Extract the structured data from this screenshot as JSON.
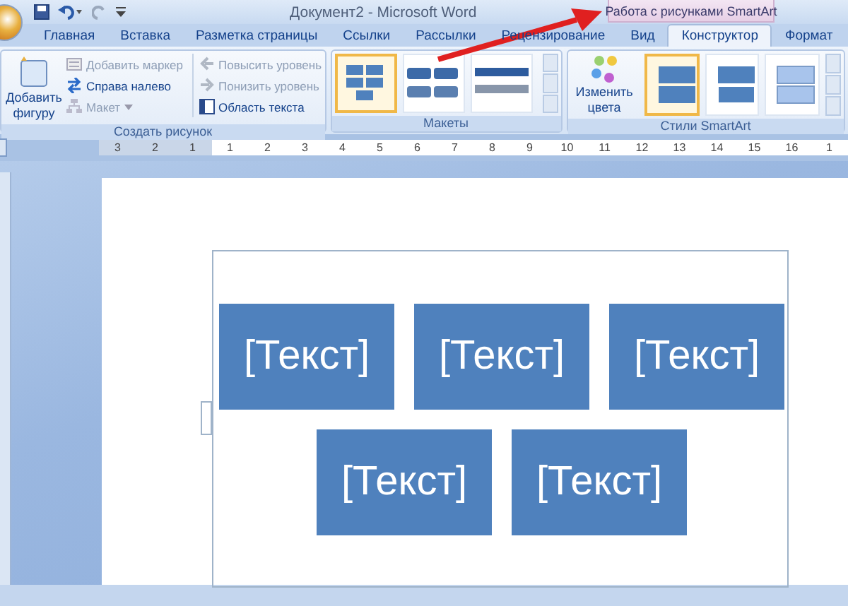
{
  "window": {
    "title": "Документ2 - Microsoft Word"
  },
  "contextual_header": "Работа с рисунками SmartArt",
  "tabs": [
    {
      "label": "Главная",
      "selected": false
    },
    {
      "label": "Вставка",
      "selected": false
    },
    {
      "label": "Разметка страницы",
      "selected": false
    },
    {
      "label": "Ссылки",
      "selected": false
    },
    {
      "label": "Рассылки",
      "selected": false
    },
    {
      "label": "Рецензирование",
      "selected": false
    },
    {
      "label": "Вид",
      "selected": false
    },
    {
      "label": "Конструктор",
      "selected": true
    },
    {
      "label": "Формат",
      "selected": false
    }
  ],
  "create_group": {
    "label": "Создать рисунок",
    "big_button": {
      "label": "Добавить фигуру"
    },
    "commands": [
      {
        "label": "Добавить маркер",
        "disabled": true,
        "kind": "bullet"
      },
      {
        "label": "Справа налево",
        "disabled": false,
        "kind": "swap"
      },
      {
        "label": "Макет",
        "disabled": true,
        "kind": "layout"
      },
      {
        "label": "Повысить уровень",
        "disabled": true,
        "kind": "promote"
      },
      {
        "label": "Понизить уровень",
        "disabled": true,
        "kind": "demote"
      },
      {
        "label": "Область текста",
        "disabled": false,
        "kind": "pane"
      }
    ]
  },
  "layouts_group": {
    "label": "Макеты",
    "items": [
      {
        "selected": true
      },
      {
        "selected": false
      },
      {
        "selected": false
      }
    ]
  },
  "styles_group": {
    "label": "Стили SmartArt",
    "colors_button": {
      "label": "Изменить цвета"
    },
    "items": [
      {
        "selected": true
      },
      {
        "selected": false
      },
      {
        "selected": false
      }
    ]
  },
  "ruler": {
    "numbers": [
      "3",
      "2",
      "1",
      "1",
      "2",
      "3",
      "4",
      "5",
      "6",
      "7",
      "8",
      "9",
      "10",
      "11",
      "12",
      "13",
      "14",
      "15",
      "16",
      "1"
    ]
  },
  "smartart": {
    "shapes": [
      {
        "text": "[Текст]"
      },
      {
        "text": "[Текст]"
      },
      {
        "text": "[Текст]"
      },
      {
        "text": "[Текст]"
      },
      {
        "text": "[Текст]"
      }
    ]
  }
}
